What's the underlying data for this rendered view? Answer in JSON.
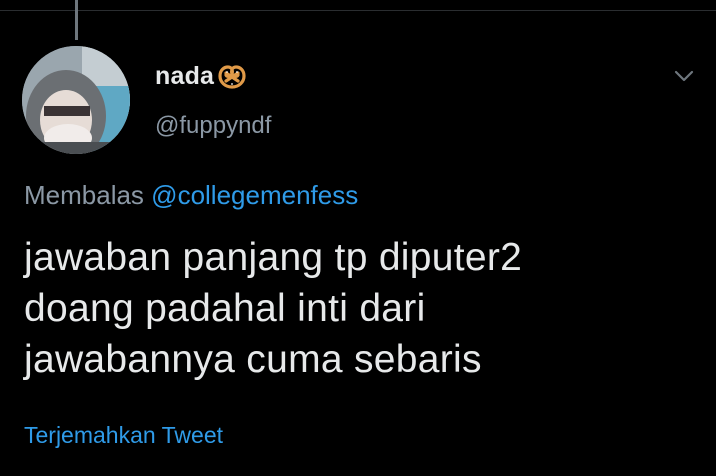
{
  "tweet": {
    "display_name": "nada",
    "name_emoji": "pretzel-icon",
    "handle": "@fuppyndf",
    "reply_prefix": "Membalas",
    "reply_to": "@collegemenfess",
    "text_lines": [
      "jawaban panjang tp diputer2",
      "doang padahal inti dari",
      "jawabannya cuma sebaris"
    ],
    "translate_label": "Terjemahkan Tweet"
  },
  "icons": {
    "more": "chevron-down-icon",
    "avatar": "avatar"
  },
  "colors": {
    "background": "#000000",
    "text": "#e7e9ea",
    "secondary": "#8b98a5",
    "link": "#2f9be8"
  }
}
